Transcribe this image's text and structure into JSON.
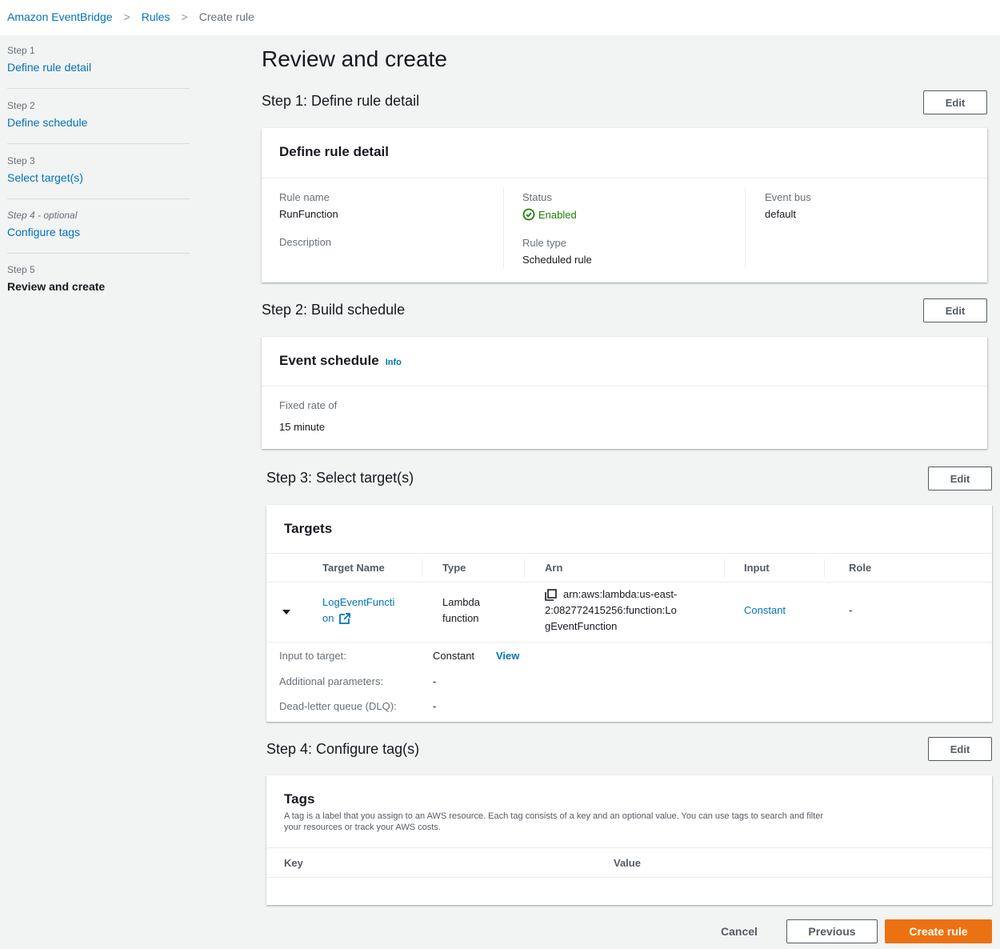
{
  "breadcrumb": {
    "root": "Amazon EventBridge",
    "rules": "Rules",
    "current": "Create rule",
    "separator": ">"
  },
  "sidebar": {
    "steps": [
      {
        "num": "Step 1",
        "label": "Define rule detail"
      },
      {
        "num": "Step 2",
        "label": "Define schedule"
      },
      {
        "num": "Step 3",
        "label": "Select target(s)"
      },
      {
        "num": "Step 4 - optional",
        "label": "Configure tags"
      },
      {
        "num": "Step 5",
        "label": "Review and create"
      }
    ]
  },
  "page": {
    "title": "Review and create",
    "edit_label": "Edit"
  },
  "step1": {
    "heading": "Step 1: Define rule detail",
    "card_title": "Define rule detail",
    "rule_name_label": "Rule name",
    "rule_name_value": "RunFunction",
    "description_label": "Description",
    "status_label": "Status",
    "status_value": "Enabled",
    "rule_type_label": "Rule type",
    "rule_type_value": "Scheduled rule",
    "event_bus_label": "Event bus",
    "event_bus_value": "default"
  },
  "step2": {
    "heading": "Step 2: Build schedule",
    "card_title": "Event schedule",
    "info": "Info",
    "rate_label": "Fixed rate of",
    "rate_value": "15 minute"
  },
  "step3": {
    "heading": "Step 3: Select target(s)",
    "card_title": "Targets",
    "columns": [
      "Target Name",
      "Type",
      "Arn",
      "Input",
      "Role"
    ],
    "row": {
      "name_line1": "LogEventFuncti",
      "name_line2": "on",
      "type_line1": "Lambda",
      "type_line2": "function",
      "arn_line1": "arn:aws:lambda:us-east-",
      "arn_line2": "2:082772415256:function:Lo",
      "arn_line3": "gEventFunction",
      "input": "Constant",
      "role": "-"
    },
    "details": {
      "input_label": "Input to target:",
      "input_value": "Constant",
      "view_link": "View",
      "params_label": "Additional parameters:",
      "params_value": "-",
      "dlq_label": "Dead-letter queue (DLQ):",
      "dlq_value": "-"
    }
  },
  "step4": {
    "heading": "Step 4: Configure tag(s)",
    "card_title": "Tags",
    "desc_line1": "A tag is a label that you assign to an AWS resource. Each tag consists of a key and an optional value. You can use tags to search and filter",
    "desc_line2": "your resources or track your AWS costs.",
    "key_col": "Key",
    "value_col": "Value"
  },
  "footer": {
    "cancel": "Cancel",
    "previous": "Previous",
    "create": "Create rule"
  },
  "colors": {
    "link": "#0073bb",
    "primary": "#ec7211",
    "success": "#1d8102"
  }
}
